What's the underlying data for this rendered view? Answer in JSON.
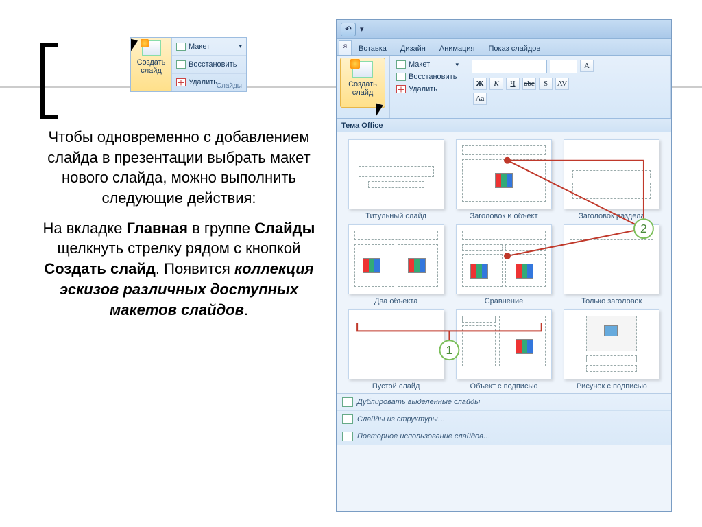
{
  "mini_ribbon": {
    "newslide_label": "Создать слайд",
    "layout": "Макет",
    "reset": "Восстановить",
    "delete": "Удалить",
    "group": "Слайды"
  },
  "text": {
    "p1a": "Чтобы одновременно с добавлением слайда в презентации выбрать макет нового слайда, можно выполнить следующие действия:",
    "p2a": "На вкладке ",
    "p2b": "Главная",
    "p2c": " в группе ",
    "p2d": "Слайды",
    "p2e": " щелкнуть стрелку рядом с кнопкой ",
    "p2f": "Создать слайд",
    "p2g": ". Появится ",
    "p2h": "коллекция эскизов различных доступных макетов слайдов",
    "p2i": "."
  },
  "pp": {
    "tabs": {
      "hidden_stub": "я",
      "insert": "Вставка",
      "design": "Дизайн",
      "animation": "Анимация",
      "slideshow": "Показ слайдов"
    },
    "ribbon": {
      "newslide": "Создать слайд",
      "layout": "Макет",
      "reset": "Восстановить",
      "delete": "Удалить",
      "bold": "Ж",
      "italic": "К",
      "underline": "Ч",
      "strike": "abc",
      "shadow": "S",
      "spacing": "AV",
      "case": "Aa",
      "bigA": "A"
    },
    "gallery": {
      "header": "Тема Office",
      "layouts": [
        "Титульный слайд",
        "Заголовок и объект",
        "Заголовок раздела",
        "Два объекта",
        "Сравнение",
        "Только заголовок",
        "Пустой слайд",
        "Объект с подписью",
        "Рисунок с подписью"
      ],
      "footer": {
        "dup": "Дублировать выделенные слайды",
        "outline": "Слайды из структуры…",
        "reuse": "Повторное использование слайдов…"
      },
      "callouts": {
        "one": "1",
        "two": "2"
      }
    }
  }
}
